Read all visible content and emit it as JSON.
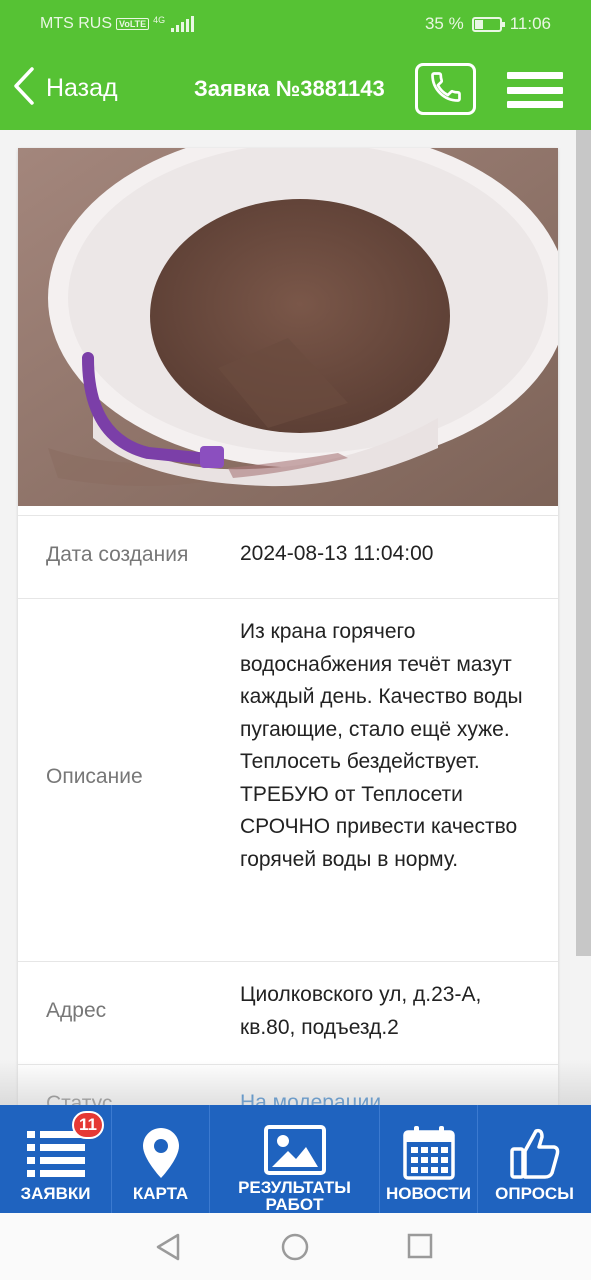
{
  "status_bar": {
    "carrier": "MTS RUS",
    "volte": "VoLTE",
    "network": "4G",
    "battery_text": "35 %",
    "battery_level": 0.35,
    "time": "11:06"
  },
  "header": {
    "back_label": "Назад",
    "title": "Заявка №3881143",
    "phone_icon": "phone-icon",
    "menu_icon": "hamburger-menu-icon",
    "background_color": "#56c234"
  },
  "details": {
    "created": {
      "label": "Дата создания",
      "value": "2024-08-13 11:04:00"
    },
    "description": {
      "label": "Описание",
      "value": "Из крана горячего водоснабжения течёт мазут каждый день. Качество воды пугающие, стало ещё хуже. Теплосеть бездействует. ТРЕБУЮ от Теплосети СРОЧНО привести качество горячей воды в норму."
    },
    "address": {
      "label": "Адрес",
      "value": "Циолковского ул, д.23-А, кв.80, подъезд.2"
    },
    "status": {
      "label": "Статус",
      "value": "На модерации"
    }
  },
  "bottom_nav": {
    "background_color": "#1f63bf",
    "requests": {
      "label": "ЗАЯВКИ",
      "badge": "11",
      "icon": "list-icon"
    },
    "map": {
      "label": "КАРТА",
      "icon": "map-pin-icon"
    },
    "results": {
      "label": "РЕЗУЛЬТАТЫ РАБОТ",
      "icon": "image-icon"
    },
    "news": {
      "label": "НОВОСТИ",
      "icon": "calendar-icon"
    },
    "polls": {
      "label": "ОПРОСЫ",
      "icon": "thumbs-up-icon"
    }
  },
  "system_nav": {
    "back_icon": "back-triangle-icon",
    "home_icon": "home-circle-icon",
    "recents_icon": "recents-square-icon"
  }
}
